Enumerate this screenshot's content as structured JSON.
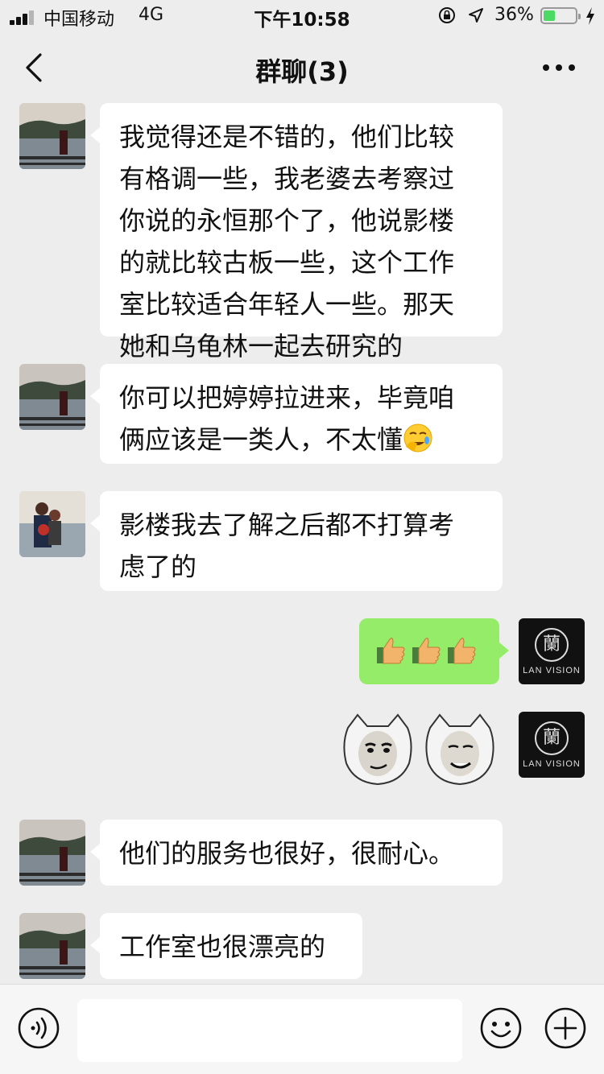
{
  "status_bar": {
    "carrier": "中国移动",
    "network": "4G",
    "time": "下午10:58",
    "battery_percent": "36%",
    "battery_level": 0.36,
    "battery_color": "#4cd964"
  },
  "nav": {
    "title": "群聊(3)",
    "back_icon": "chevron-left-icon",
    "more_icon": "ellipsis-icon"
  },
  "messages": [
    {
      "side": "left",
      "avatar": "lake-photo",
      "lines": [
        "我觉得还是不错的，他们比较",
        "有格调一些，我老婆去考察过",
        "你说的永恒那个了，他说影楼",
        "的就比较古板一些，这个工作",
        "室比较适合年轻人一些。那天",
        "她和乌龟林一起去研究的"
      ]
    },
    {
      "side": "left",
      "avatar": "lake-photo",
      "lines": [
        "你可以把婷婷拉进来，毕竟咱",
        "俩应该是一类人，不太懂"
      ],
      "trailing_emoji": "facepalm-crying-emoji"
    },
    {
      "side": "left",
      "avatar": "couple-photo",
      "lines": [
        "影楼我去了解之后都不打算考",
        "虑了的"
      ]
    },
    {
      "side": "right",
      "avatar": "lan-vision-logo",
      "avatar_text": "LAN VISION",
      "avatar_glyph": "蘭",
      "emojis": [
        "thumbs-up-emoji",
        "thumbs-up-emoji",
        "thumbs-up-emoji"
      ]
    },
    {
      "side": "right",
      "avatar": "lan-vision-logo",
      "avatar_text": "LAN VISION",
      "avatar_glyph": "蘭",
      "stickers": [
        "face-cat-sticker-smirk",
        "face-cat-sticker-smile"
      ]
    },
    {
      "side": "left",
      "avatar": "lake-photo",
      "lines": [
        "他们的服务也很好，很耐心。"
      ]
    },
    {
      "side": "left",
      "avatar": "lake-photo",
      "lines": [
        "工作室也很漂亮的"
      ]
    }
  ],
  "input_bar": {
    "voice_icon": "voice-icon",
    "input_value": "",
    "emoji_icon": "smiley-icon",
    "plus_icon": "plus-icon"
  },
  "colors": {
    "background": "#ededed",
    "bubble_left": "#ffffff",
    "bubble_right": "#95ec69"
  }
}
